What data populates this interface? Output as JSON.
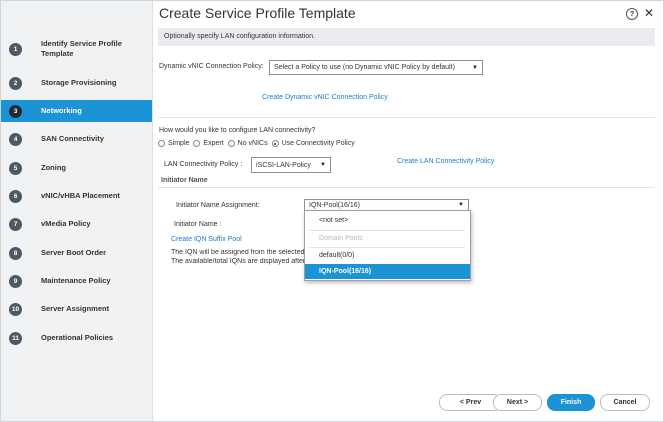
{
  "sidebar": {
    "items": [
      {
        "num": "1",
        "label": "Identify Service Profile Template",
        "active": false
      },
      {
        "num": "2",
        "label": "Storage Provisioning",
        "active": false
      },
      {
        "num": "3",
        "label": "Networking",
        "active": true
      },
      {
        "num": "4",
        "label": "SAN Connectivity",
        "active": false
      },
      {
        "num": "5",
        "label": "Zoning",
        "active": false
      },
      {
        "num": "6",
        "label": "vNIC/vHBA Placement",
        "active": false
      },
      {
        "num": "7",
        "label": "vMedia Policy",
        "active": false
      },
      {
        "num": "8",
        "label": "Server Boot Order",
        "active": false
      },
      {
        "num": "9",
        "label": "Maintenance Policy",
        "active": false
      },
      {
        "num": "10",
        "label": "Server Assignment",
        "active": false
      },
      {
        "num": "11",
        "label": "Operational Policies",
        "active": false
      }
    ]
  },
  "header": {
    "title": "Create Service Profile Template",
    "help_glyph": "?",
    "close_glyph": "✕",
    "banner": "Optionally specify LAN configuration information."
  },
  "dynamic_vnic": {
    "label": "Dynamic vNIC Connection Policy:",
    "value": "Select a Policy to use (no Dynamic vNIC Policy by default)",
    "create_link": "Create Dynamic vNIC Connection Policy"
  },
  "lan": {
    "question": "How would you like to configure LAN connectivity?",
    "options": [
      {
        "label": "Simple",
        "selected": false
      },
      {
        "label": "Expert",
        "selected": false
      },
      {
        "label": "No vNICs",
        "selected": false
      },
      {
        "label": "Use Connectivity Policy",
        "selected": true
      }
    ],
    "policy_label": "LAN Connectivity Policy :",
    "policy_value": "iSCSI-LAN-Policy",
    "create_link": "Create LAN Connectivity Policy"
  },
  "initiator": {
    "section_title": "Initiator Name",
    "assignment_label": "Initiator Name Assignment:",
    "assignment_value": "IQN-Pool(16/16)",
    "name_label": "Initiator Name :",
    "create_link": "Create IQN Suffix Pool",
    "info_line1": "The IQN will be assigned from the selected pool.",
    "info_line2": "The available/total IQNs are displayed after the pool name."
  },
  "dropdown": {
    "items": [
      {
        "label": "<not set>",
        "type": "option"
      },
      {
        "label": "Domain Pools",
        "type": "header"
      },
      {
        "label": "default(0/0)",
        "type": "option"
      },
      {
        "label": "IQN-Pool(16/16)",
        "type": "selected"
      }
    ]
  },
  "footer": {
    "prev": "< Prev",
    "next": "Next >",
    "finish": "Finish",
    "cancel": "Cancel"
  },
  "colors": {
    "accent": "#1c93d4",
    "link": "#1c7cd4",
    "sidebar_bg": "#f1f2f4"
  },
  "icons": {
    "caret": "▼"
  }
}
